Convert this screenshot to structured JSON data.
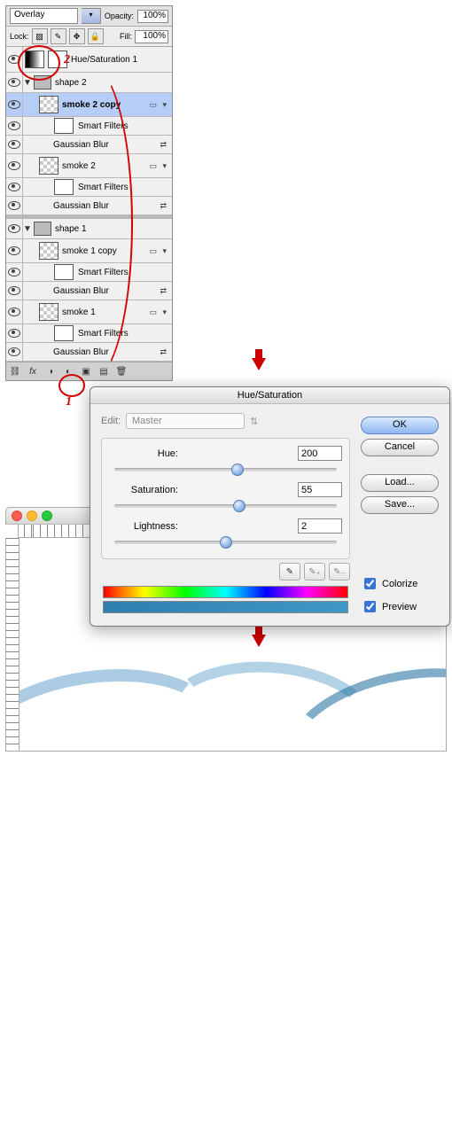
{
  "panel": {
    "blend_mode": "Overlay",
    "opacity_label": "Opacity:",
    "opacity_value": "100%",
    "lock_label": "Lock:",
    "fill_label": "Fill:",
    "fill_value": "100%",
    "layers": {
      "adj": "Hue/Saturation 1",
      "group_a": "shape 2",
      "smoke_a_copy": "smoke 2 copy",
      "smoke_a": "smoke 2",
      "group_b": "shape 1",
      "smoke_b_copy": "smoke 1 copy",
      "smoke_b": "smoke 1",
      "smart_filters": "Smart Filters",
      "gaussian": "Gaussian Blur"
    }
  },
  "callouts": {
    "n1": "1",
    "n2": "2"
  },
  "dialog": {
    "title": "Hue/Saturation",
    "edit_label": "Edit:",
    "edit_value": "Master",
    "hue_label": "Hue:",
    "hue_value": "200",
    "sat_label": "Saturation:",
    "sat_value": "55",
    "light_label": "Lightness:",
    "light_value": "2",
    "ok": "OK",
    "cancel": "Cancel",
    "load": "Load...",
    "save": "Save...",
    "colorize": "Colorize",
    "preview": "Preview",
    "colorize_on": true,
    "preview_on": true
  },
  "chart_data": {
    "type": "table",
    "title": "Hue/Saturation adjustment values",
    "rows": [
      {
        "param": "Hue",
        "value": 200,
        "range": [
          0,
          360
        ]
      },
      {
        "param": "Saturation",
        "value": 55,
        "range": [
          0,
          100
        ]
      },
      {
        "param": "Lightness",
        "value": 2,
        "range": [
          -100,
          100
        ]
      }
    ],
    "flags": {
      "Colorize": true,
      "Preview": true
    },
    "edit_scope": "Master"
  }
}
